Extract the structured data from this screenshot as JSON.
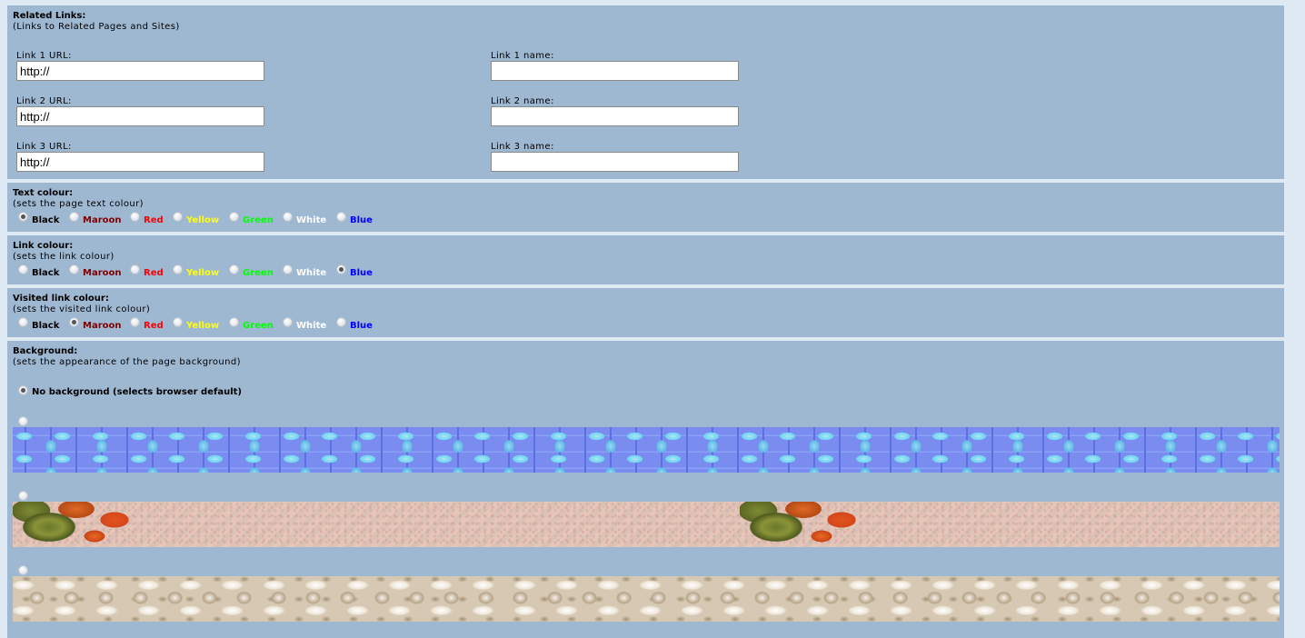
{
  "related_links": {
    "title": "Related Links:",
    "subtitle": "(Links to Related Pages and Sites)",
    "links": [
      {
        "url_label": "Link 1 URL:",
        "url_value": "http://",
        "name_label": "Link 1 name:",
        "name_value": ""
      },
      {
        "url_label": "Link 2 URL:",
        "url_value": "http://",
        "name_label": "Link 2 name:",
        "name_value": ""
      },
      {
        "url_label": "Link 3 URL:",
        "url_value": "http://",
        "name_label": "Link 3 name:",
        "name_value": ""
      }
    ]
  },
  "text_colour": {
    "title": "Text colour:",
    "subtitle": "(sets the page text colour)",
    "selected": "Black"
  },
  "link_colour": {
    "title": "Link colour:",
    "subtitle": "(sets the link colour)",
    "selected": "Blue"
  },
  "visited_link_colour": {
    "title": "Visited link colour:",
    "subtitle": "(sets the visited link colour)",
    "selected": "Maroon"
  },
  "colour_options": [
    {
      "label": "Black",
      "color": "#000000"
    },
    {
      "label": "Maroon",
      "color": "#800000"
    },
    {
      "label": "Red",
      "color": "#ff0000"
    },
    {
      "label": "Yellow",
      "color": "#ffff00"
    },
    {
      "label": "Green",
      "color": "#00ff00"
    },
    {
      "label": "White",
      "color": "#ffffff"
    },
    {
      "label": "Blue",
      "color": "#0000ff"
    }
  ],
  "background": {
    "title": "Background:",
    "subtitle": "(sets the appearance of the page background)",
    "no_background_label": "No background (selects browser default)",
    "selected": "none",
    "options": [
      {
        "id": "none"
      },
      {
        "id": "blue-mosaic"
      },
      {
        "id": "autumn-leaves"
      },
      {
        "id": "cream-marble"
      }
    ]
  },
  "colors": {
    "panel": "#9fb8d2",
    "page": "#dfe9f4"
  }
}
